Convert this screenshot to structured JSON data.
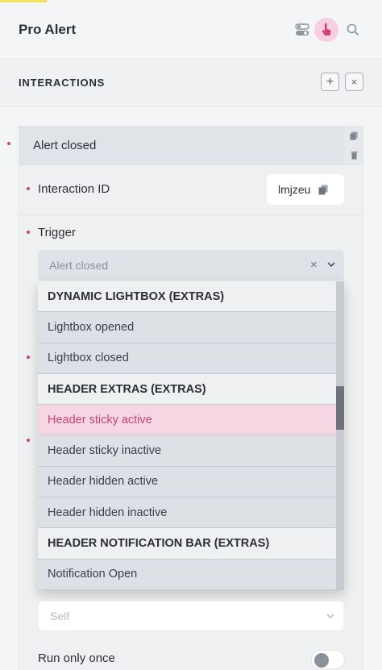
{
  "header": {
    "title": "Pro Alert",
    "icons": [
      "toggles-icon",
      "pointer-hand-icon",
      "search-icon"
    ]
  },
  "interactions": {
    "section_title": "INTERACTIONS",
    "add_label": "+",
    "remove_label": "×"
  },
  "item": {
    "title": "Alert closed",
    "interaction_id_label": "Interaction ID",
    "interaction_id_value": "lmjzeu",
    "trigger_label": "Trigger",
    "trigger_value": "Alert closed",
    "clear_symbol": "×",
    "target_value": "Self",
    "run_only_once_label": "Run only once"
  },
  "dropdown": {
    "options": [
      {
        "label": "DYNAMIC LIGHTBOX (EXTRAS)",
        "kind": "group"
      },
      {
        "label": "Lightbox opened",
        "kind": "option"
      },
      {
        "label": "Lightbox closed",
        "kind": "option"
      },
      {
        "label": "HEADER EXTRAS (EXTRAS)",
        "kind": "group"
      },
      {
        "label": "Header sticky active",
        "kind": "active"
      },
      {
        "label": "Header sticky inactive",
        "kind": "option"
      },
      {
        "label": "Header hidden active",
        "kind": "option"
      },
      {
        "label": "Header hidden inactive",
        "kind": "option"
      },
      {
        "label": "HEADER NOTIFICATION BAR (EXTRAS)",
        "kind": "group"
      },
      {
        "label": "Notification Open",
        "kind": "option"
      }
    ]
  },
  "colors": {
    "accent_pink": "#d0417a",
    "active_option_bg": "#f6d6e2",
    "pointer_icon_bg": "#f7cfdf"
  }
}
